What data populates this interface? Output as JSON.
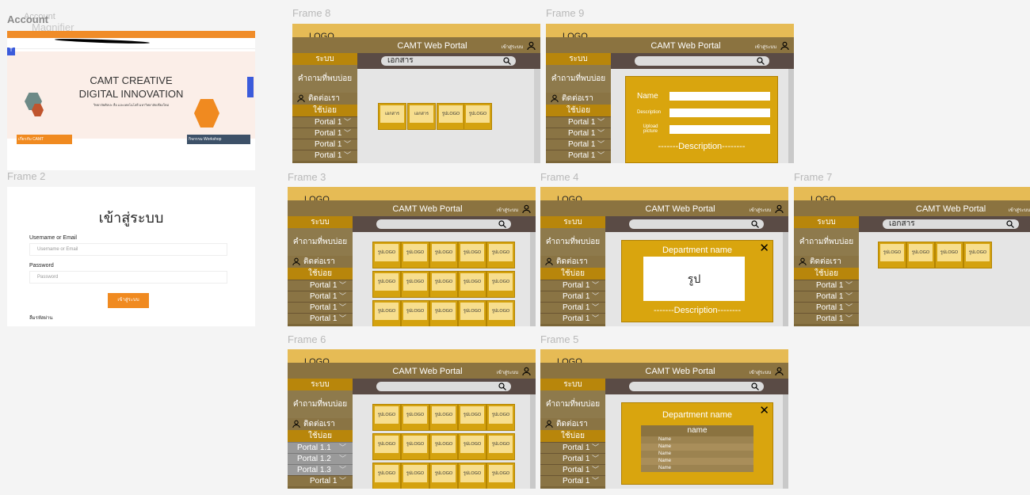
{
  "overlay": {
    "account": "Account",
    "magnifier": "Magnifier"
  },
  "frames_labels": {
    "f2": "Frame 2",
    "f8": "Frame 8",
    "f9": "Frame 9",
    "f3": "Frame 3",
    "f4": "Frame 4",
    "f7": "Frame 7",
    "f6": "Frame 6",
    "f5": "Frame 5"
  },
  "portal": {
    "logo": "LOGO",
    "title": "CAMT Web Portal",
    "login": "เข้าสู่ระบบ",
    "sys": "ระบบ",
    "faq": "คำถามที่พบบ่อย",
    "contact": "ติดต่อเรา",
    "used": "ใช้บ่อย",
    "portal": "Portal 1",
    "p11": "Portal 1.1",
    "p12": "Portal 1.2",
    "p13": "Portal 1.3",
    "search_doc": "เอกสาร",
    "card_logo": "รูปLOGO",
    "card_doc": "เอกสาร",
    "dept": "Department name",
    "desc": "-------Description--------",
    "pic": "รูป",
    "name_head": "name",
    "name": "Name",
    "description": "Description",
    "upload": "Upload picture"
  },
  "website": {
    "hero1": "CAMT CREATIVE",
    "hero2": "DIGITAL INNOVATION",
    "sub": "วิทยาลัยศิลปะ สื่อ และเทคโนโลยี มหาวิทยาลัยเชียงใหม่",
    "b1": "เกี่ยวกับ CAMT",
    "b3": "กิจกรรม Workshop"
  },
  "login": {
    "title": "เข้าสู่ระบบ",
    "user_label": "Username or Email",
    "user_ph": "Username or Email",
    "pw_label": "Password",
    "pw_ph": "Password",
    "btn": "เข้าสู่ระบบ",
    "forgot": "ลืมรหัสผ่าน"
  }
}
